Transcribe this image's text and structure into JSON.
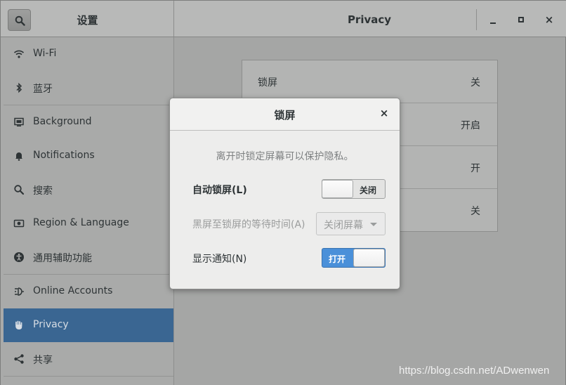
{
  "headerbar": {
    "left_title": "设置",
    "title": "Privacy",
    "minimize_icon": "minimize-icon",
    "maximize_icon": "maximize-icon",
    "close_label": "×"
  },
  "sidebar": {
    "items": [
      {
        "label": "Wi-Fi",
        "icon": "wifi-icon"
      },
      {
        "label": "蓝牙",
        "icon": "bluetooth-icon"
      },
      {
        "label": "Background",
        "icon": "background-icon"
      },
      {
        "label": "Notifications",
        "icon": "bell-icon"
      },
      {
        "label": "搜索",
        "icon": "search-icon"
      },
      {
        "label": "Region & Language",
        "icon": "camera-icon"
      },
      {
        "label": "通用辅助功能",
        "icon": "accessibility-icon"
      },
      {
        "label": "Online Accounts",
        "icon": "online-accounts-icon"
      },
      {
        "label": "Privacy",
        "icon": "hand-icon",
        "active": true
      },
      {
        "label": "共享",
        "icon": "share-icon"
      }
    ]
  },
  "privacy_list": {
    "rows": [
      {
        "label": "锁屏",
        "value": "关"
      },
      {
        "label": "",
        "value": "开启"
      },
      {
        "label": "",
        "value": "开"
      },
      {
        "label": "",
        "value": "关"
      }
    ]
  },
  "dialog": {
    "title": "锁屏",
    "close_label": "×",
    "description": "离开时锁定屏幕可以保护隐私。",
    "auto_lock": {
      "label": "自动锁屏(L)",
      "state_label": "关闭",
      "on": false
    },
    "blank_delay": {
      "label": "黑屏至锁屏的等待时间(A)",
      "value": "关闭屏幕"
    },
    "show_notifications": {
      "label": "显示通知(N)",
      "state_label": "打开",
      "on": true
    }
  },
  "watermark": "https://blog.csdn.net/ADwenwen",
  "colors": {
    "accent": "#4a90d9",
    "sidebar_active": "#3a6692"
  }
}
